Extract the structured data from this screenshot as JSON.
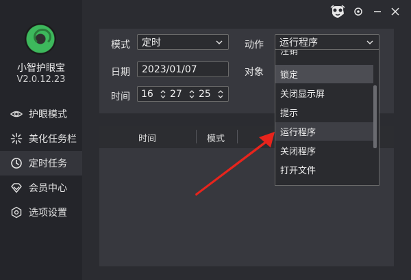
{
  "app": {
    "name": "小智护眼宝",
    "version": "V2.0.12.23"
  },
  "nav": [
    {
      "label": "护眼模式",
      "icon": "eye-icon"
    },
    {
      "label": "美化任务栏",
      "icon": "sparkle-icon"
    },
    {
      "label": "定时任务",
      "icon": "clock-icon",
      "active": true
    },
    {
      "label": "会员中心",
      "icon": "diamond-icon"
    },
    {
      "label": "选项设置",
      "icon": "settings-icon"
    }
  ],
  "form": {
    "mode_label": "模式",
    "mode_value": "定时",
    "action_label": "动作",
    "action_value": "运行程序",
    "date_label": "日期",
    "date_value": "2023/01/07",
    "target_label": "对象",
    "time_label": "时间",
    "hour": "16",
    "minute": "27",
    "second": "25"
  },
  "table": {
    "headers": [
      "时间",
      "模式"
    ]
  },
  "dropdown": {
    "items": [
      "注销",
      "锁定",
      "关闭显示屏",
      "提示",
      "运行程序",
      "关闭程序",
      "打开文件"
    ],
    "selected": "锁定",
    "hovered": "运行程序"
  }
}
